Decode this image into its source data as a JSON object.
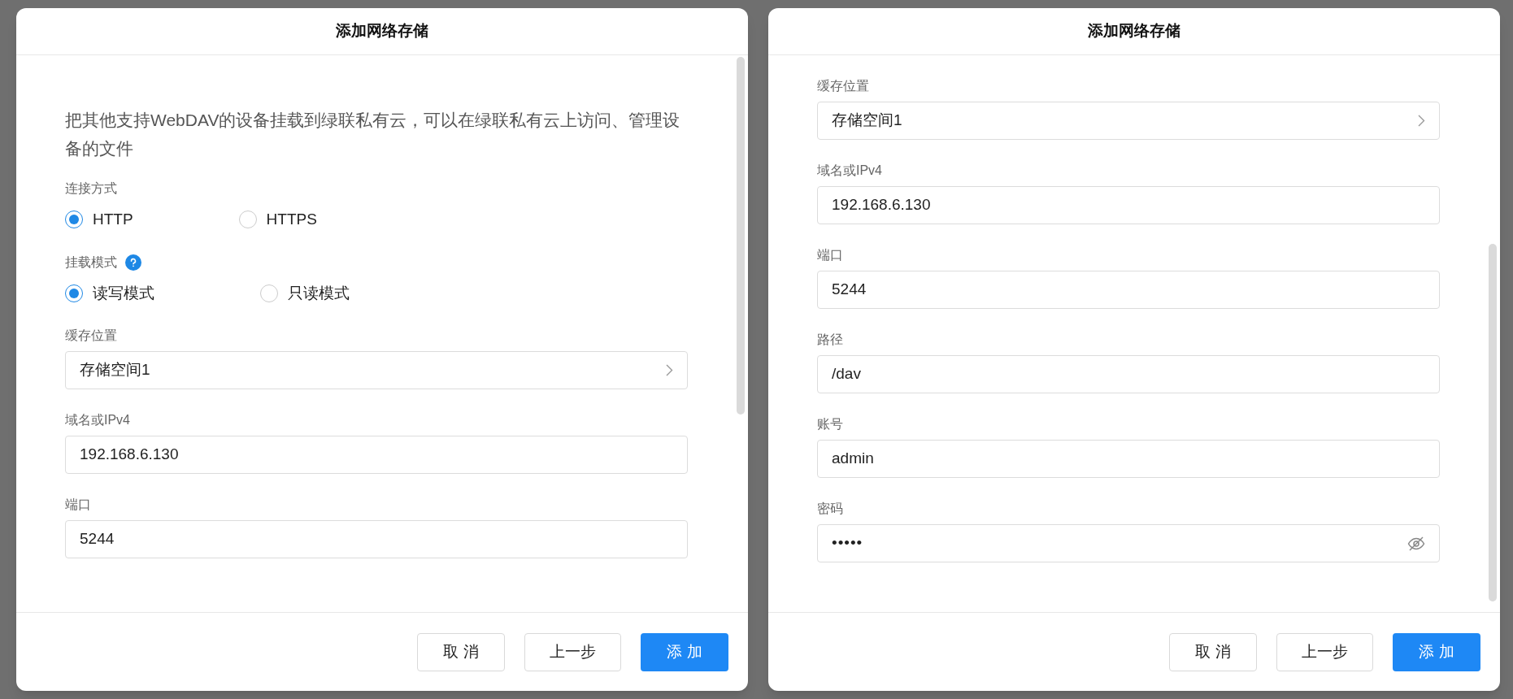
{
  "dialogs": [
    {
      "title": "添加网络存储",
      "items": [
        {
          "kind": "paragraph",
          "text": "把其他支持WebDAV的设备挂载到绿联私有云，可以在绿联私有云上访问、管理设备的文件"
        },
        {
          "kind": "radio_group",
          "label": "连接方式",
          "help": false,
          "options": [
            {
              "label": "HTTP",
              "selected": true
            },
            {
              "label": "HTTPS",
              "selected": false
            }
          ]
        },
        {
          "kind": "radio_group",
          "label": "挂载模式",
          "help": true,
          "options": [
            {
              "label": "读写模式",
              "selected": true
            },
            {
              "label": "只读模式",
              "selected": false
            }
          ]
        },
        {
          "kind": "select",
          "label": "缓存位置",
          "value": "存储空间1"
        },
        {
          "kind": "text",
          "label": "域名或IPv4",
          "value": "192.168.6.130"
        },
        {
          "kind": "text",
          "label": "端口",
          "value": "5244"
        }
      ],
      "buttons": [
        {
          "label": "取 消",
          "primary": false
        },
        {
          "label": "上一步",
          "primary": false
        },
        {
          "label": "添 加",
          "primary": true
        }
      ]
    },
    {
      "title": "添加网络存储",
      "items": [
        {
          "kind": "select",
          "label": "缓存位置",
          "value": "存储空间1"
        },
        {
          "kind": "text",
          "label": "域名或IPv4",
          "value": "192.168.6.130"
        },
        {
          "kind": "text",
          "label": "端口",
          "value": "5244"
        },
        {
          "kind": "text",
          "label": "路径",
          "value": "/dav"
        },
        {
          "kind": "text",
          "label": "账号",
          "value": "admin"
        },
        {
          "kind": "password",
          "label": "密码",
          "value": "•••••"
        }
      ],
      "buttons": [
        {
          "label": "取 消",
          "primary": false
        },
        {
          "label": "上一步",
          "primary": false
        },
        {
          "label": "添 加",
          "primary": true
        }
      ]
    }
  ]
}
